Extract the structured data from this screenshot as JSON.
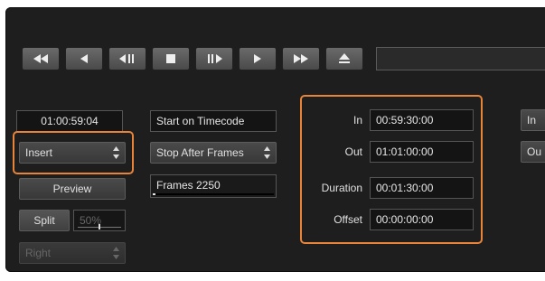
{
  "transport": {
    "buttons": [
      "rewind",
      "previous-frame",
      "step-back",
      "stop",
      "step-forward",
      "play",
      "fast-forward",
      "eject"
    ]
  },
  "left": {
    "timecode": "01:00:59:04",
    "mode_select": "Insert",
    "preview_label": "Preview",
    "split_label": "Split",
    "split_percent": "50%",
    "split_value": 0.5,
    "side_select": "Right"
  },
  "middle": {
    "start_on": "Start on Timecode",
    "stop_after": "Stop After Frames",
    "frames_label": "Frames 2250",
    "frames_progress": 0.0
  },
  "timing": {
    "in_label": "In",
    "in_value": "00:59:30:00",
    "out_label": "Out",
    "out_value": "01:01:00:00",
    "duration_label": "Duration",
    "duration_value": "00:01:30:00",
    "offset_label": "Offset",
    "offset_value": "00:00:00:00"
  },
  "right": {
    "in_button": "In",
    "out_button": "Ou"
  },
  "colors": {
    "highlight": "#e8833a",
    "panel": "#1e1e1e"
  }
}
